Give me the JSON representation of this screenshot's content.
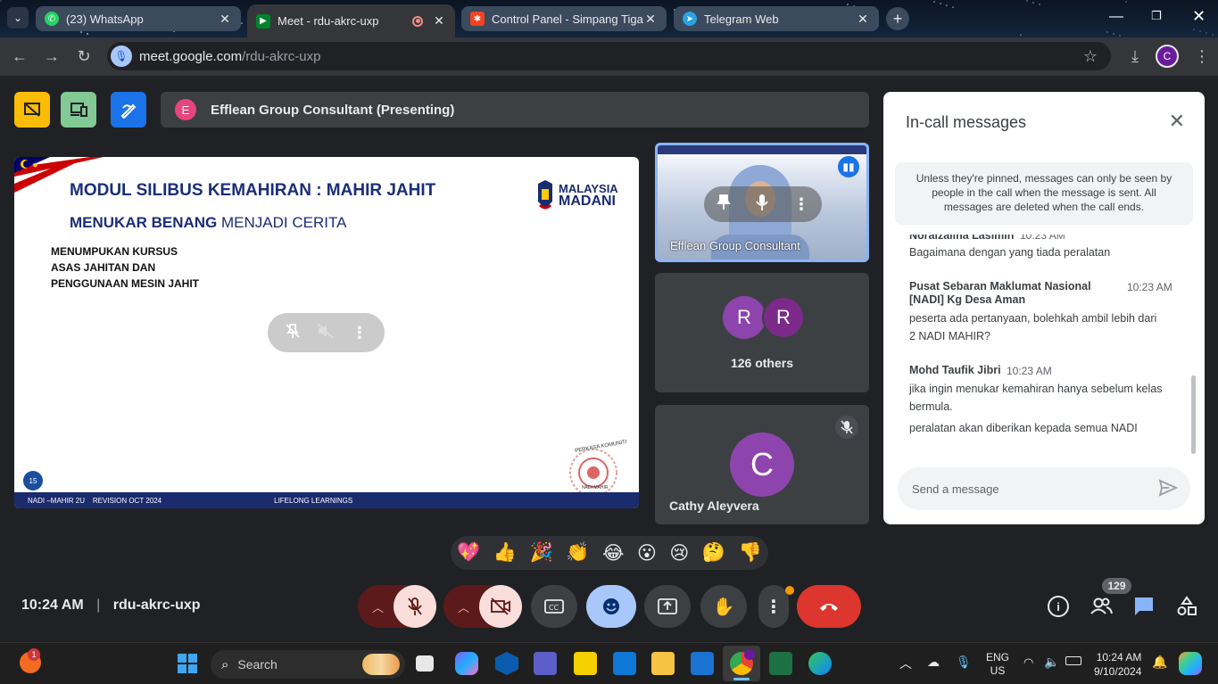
{
  "browser": {
    "tabs": [
      {
        "title": "(23) WhatsApp",
        "icon": "whatsapp-icon"
      },
      {
        "title": "Meet - rdu-akrc-uxp",
        "icon": "meet-icon",
        "active": true,
        "recording": true
      },
      {
        "title": "Control Panel - Simpang Tiga L",
        "icon": "joomla-icon"
      },
      {
        "title": "Telegram Web",
        "icon": "telegram-icon"
      }
    ],
    "url_domain": "meet.google.com",
    "url_path": "/rdu-akrc-uxp",
    "profile_initial": "C"
  },
  "meet": {
    "presenter_initial": "E",
    "presenter_label": "Efflean Group Consultant (Presenting)",
    "slide": {
      "title": "MODUL SILIBUS KEMAHIRAN : MAHIR JAHIT",
      "subtitle_bold": "MENUKAR BENANG",
      "subtitle_rest": " MENJADI CERITA",
      "list": [
        "MENUMPUKAN KURSUS",
        "ASAS JAHITAN DAN",
        "PENGGUNAAN MESIN JAHIT"
      ],
      "logo_line1": "MALAYSIA",
      "logo_line2": "MADANI",
      "page_number": "15",
      "footer_left": "NADI –MAHIR 2U    REVISION OCT 2024",
      "footer_mid": "LIFELONG LEARNINGS",
      "seal_text_top": "PERKASA KOMUNITI",
      "seal_text_bottom": "NADI MAHIR"
    },
    "self_tile": {
      "name": "Efflean Group Consultant"
    },
    "others_tile": {
      "avatar1": "R",
      "avatar2": "R",
      "label": "126 others"
    },
    "cathy_tile": {
      "initial": "C",
      "name": "Cathy Aleyvera"
    },
    "clock": "10:24 AM",
    "meeting_code": "rdu-akrc-uxp",
    "participants_count": "129",
    "reactions": [
      "💖",
      "👍",
      "🎉",
      "👏",
      "😂",
      "😮",
      "😢",
      "🤔",
      "👎"
    ]
  },
  "chat": {
    "title": "In-call messages",
    "notice": "Unless they're pinned, messages can only be seen by people in the call when the message is sent. All messages are deleted when the call ends.",
    "partial_sender": "Noralzalina Lasimin",
    "partial_time": "10:23 AM",
    "messages": [
      {
        "text": "Bagaimana dengan yang tiada peralatan"
      },
      {
        "sender_line1": "Pusat Sebaran Maklumat Nasional",
        "sender_line2": "[NADI] Kg Desa Aman",
        "time": "10:23 AM",
        "text1": "peserta ada pertanyaan, bolehkah ambil lebih dari",
        "text2": "2 NADI MAHIR?"
      },
      {
        "sender": "Mohd Taufik Jibri",
        "time": "10:23 AM",
        "text1": "jika ingin menukar kemahiran hanya sebelum kelas",
        "text2": "bermula.",
        "text3": "peralatan akan diberikan kepada semua NADI"
      }
    ],
    "input_placeholder": "Send a message"
  },
  "taskbar": {
    "search_placeholder": "Search",
    "notification_badge": "1",
    "lang_line1": "ENG",
    "lang_line2": "US",
    "time": "10:24 AM",
    "date": "9/10/2024"
  }
}
